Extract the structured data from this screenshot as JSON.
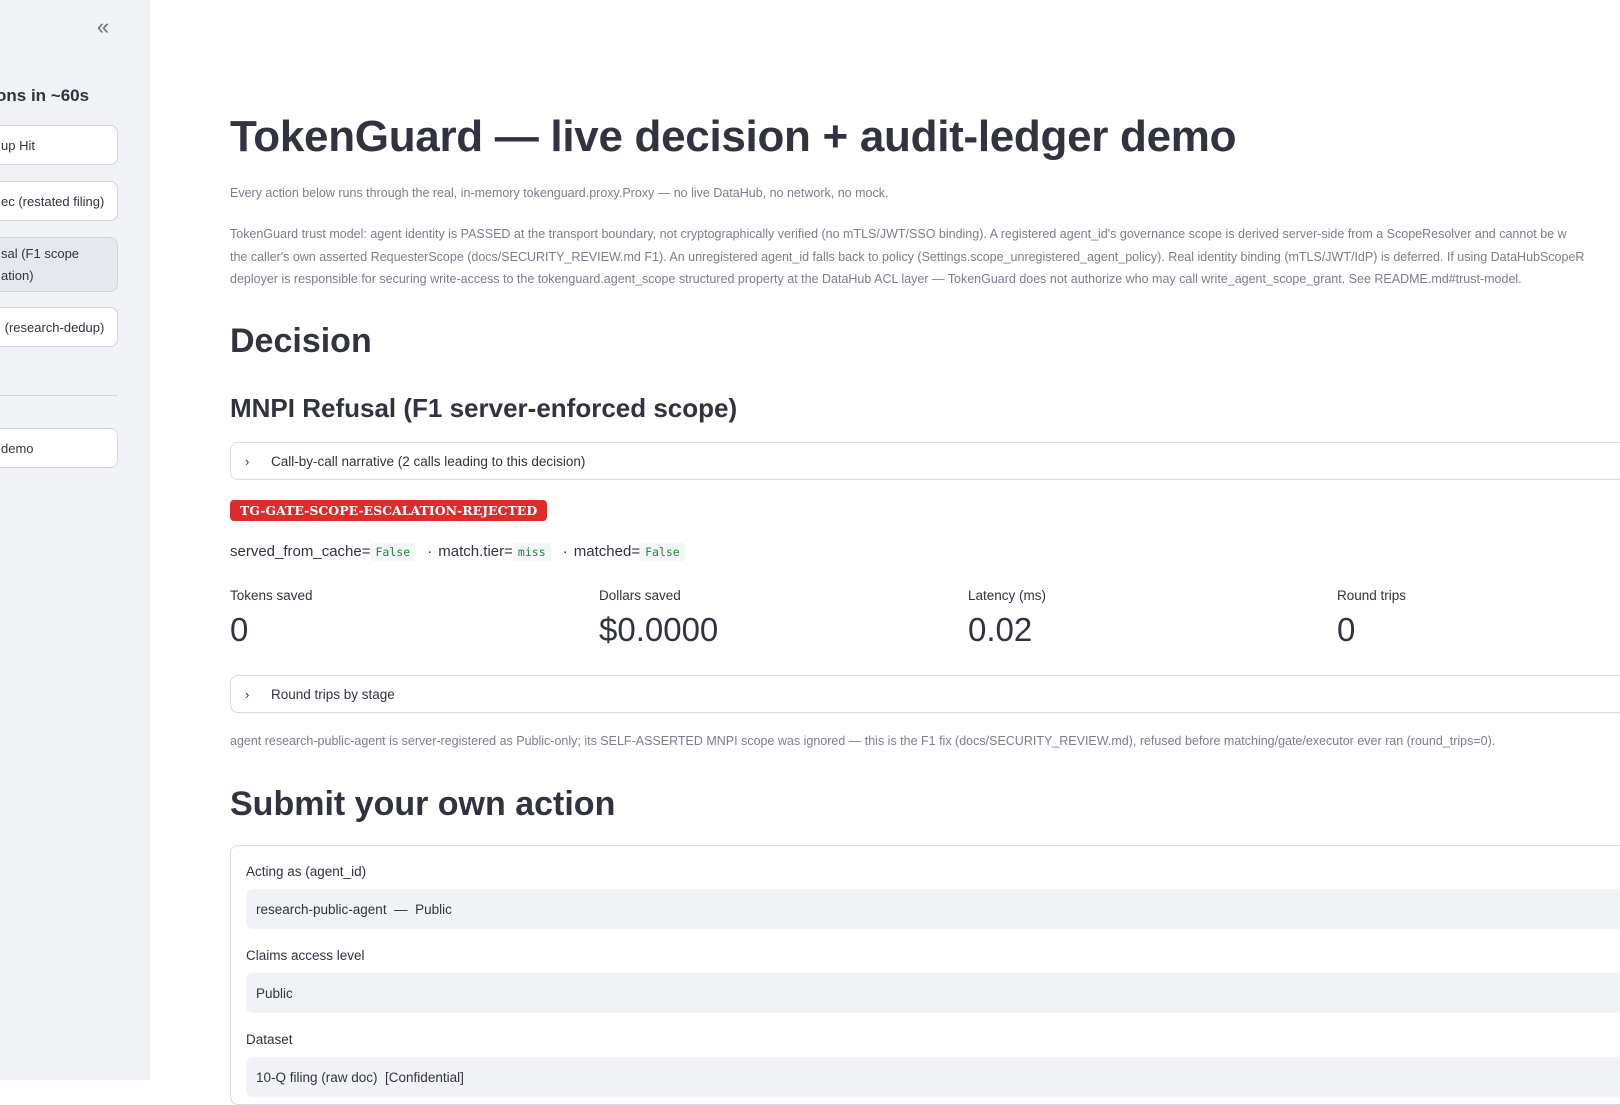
{
  "sidebar": {
    "collapse_icon": "double-chevron-left-icon",
    "collapse_glyph": "«",
    "title": "ons in ~60s",
    "buttons": [
      {
        "label": "up Hit"
      },
      {
        "label": "ec (restated filing)"
      },
      {
        "label_line1": "sal (F1 scope",
        "label_line2": "ation)"
      },
      {
        "label": " (research-dedup)"
      },
      {
        "label": "demo"
      }
    ]
  },
  "main": {
    "title": "TokenGuard — live decision + audit-ledger demo",
    "subtitle": "Every action below runs through the real, in-memory tokenguard.proxy.Proxy — no live DataHub, no network, no mock.",
    "trust_model_lines": [
      "TokenGuard trust model: agent identity is PASSED at the transport boundary, not cryptographically verified (no mTLS/JWT/SSO binding). A registered agent_id's governance scope is derived server-side from a ScopeResolver and cannot be w",
      "the caller's own asserted RequesterScope (docs/SECURITY_REVIEW.md F1). An unregistered agent_id falls back to policy (Settings.scope_unregistered_agent_policy). Real identity binding (mTLS/JWT/IdP) is deferred. If using DataHubScopeR",
      "deployer is responsible for securing write-access to the tokenguard.agent_scope structured property at the DataHub ACL layer — TokenGuard does not authorize who may call write_agent_scope_grant. See README.md#trust-model."
    ],
    "decision_heading": "Decision",
    "scenario_heading": "MNPI Refusal (F1 server-enforced scope)",
    "narrative_expander": "Call-by-call narrative (2 calls leading to this decision)",
    "expander_icon": "chevron-right-icon",
    "expander_glyph": "›",
    "status_badge": "TG-GATE-SCOPE-ESCALATION-REJECTED",
    "status_color": "#dc2c2c",
    "flags": [
      {
        "key": "served_from_cache=",
        "value": "False"
      },
      {
        "key": "match.tier=",
        "value": "miss"
      },
      {
        "key": "matched=",
        "value": "False"
      }
    ],
    "flag_separator": "·",
    "metrics": [
      {
        "label": "Tokens saved",
        "value": "0"
      },
      {
        "label": "Dollars saved",
        "value": "$0.0000"
      },
      {
        "label": "Latency (ms)",
        "value": "0.02"
      },
      {
        "label": "Round trips",
        "value": "0"
      }
    ],
    "round_trips_expander": "Round trips by stage",
    "explanation": "agent research-public-agent is server-registered as Public-only; its SELF-ASSERTED MNPI scope was ignored — this is the F1 fix (docs/SECURITY_REVIEW.md), refused before matching/gate/executor ever ran (round_trips=0).",
    "submit_heading": "Submit your own action",
    "form": {
      "agent_label": "Acting as (agent_id)",
      "agent_value": "research-public-agent  —  Public",
      "access_label": "Claims access level",
      "access_value": "Public",
      "dataset_label": "Dataset",
      "dataset_value": "10-Q filing (raw doc)  [Confidential]"
    }
  }
}
